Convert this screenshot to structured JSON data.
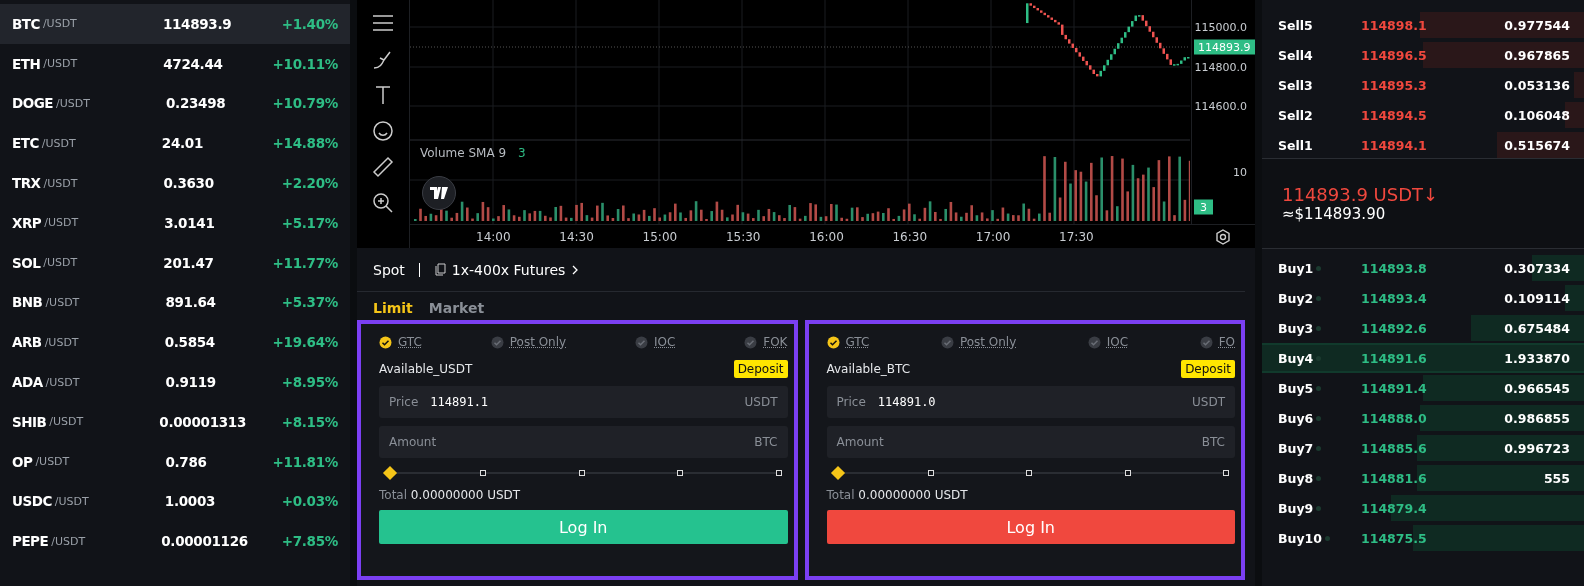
{
  "markets": [
    {
      "base": "BTC",
      "quote": "/USDT",
      "price": "114893.9",
      "change": "+1.40%",
      "selected": true
    },
    {
      "base": "ETH",
      "quote": "/USDT",
      "price": "4724.44",
      "change": "+10.11%",
      "selected": false
    },
    {
      "base": "DOGE",
      "quote": "/USDT",
      "price": "0.23498",
      "change": "+10.79%",
      "selected": false
    },
    {
      "base": "ETC",
      "quote": "/USDT",
      "price": "24.01",
      "change": "+14.88%",
      "selected": false
    },
    {
      "base": "TRX",
      "quote": "/USDT",
      "price": "0.3630",
      "change": "+2.20%",
      "selected": false
    },
    {
      "base": "XRP",
      "quote": "/USDT",
      "price": "3.0141",
      "change": "+5.17%",
      "selected": false
    },
    {
      "base": "SOL",
      "quote": "/USDT",
      "price": "201.47",
      "change": "+11.77%",
      "selected": false
    },
    {
      "base": "BNB",
      "quote": "/USDT",
      "price": "891.64",
      "change": "+5.37%",
      "selected": false
    },
    {
      "base": "ARB",
      "quote": "/USDT",
      "price": "0.5854",
      "change": "+19.64%",
      "selected": false
    },
    {
      "base": "ADA",
      "quote": "/USDT",
      "price": "0.9119",
      "change": "+8.95%",
      "selected": false
    },
    {
      "base": "SHIB",
      "quote": "/USDT",
      "price": "0.00001313",
      "change": "+8.15%",
      "selected": false
    },
    {
      "base": "OP",
      "quote": "/USDT",
      "price": "0.786",
      "change": "+11.81%",
      "selected": false
    },
    {
      "base": "USDC",
      "quote": "/USDT",
      "price": "1.0003",
      "change": "+0.03%",
      "selected": false
    },
    {
      "base": "PEPE",
      "quote": "/USDT",
      "price": "0.00001126",
      "change": "+7.85%",
      "selected": false
    }
  ],
  "chart": {
    "price_ticks": [
      "115000.0",
      "114800.0",
      "114600.0"
    ],
    "last_price": "114893.9",
    "volume_label": "Volume SMA 9",
    "volume_value": "3",
    "volume_tick": "10",
    "volume_tag": "3",
    "time_ticks": [
      "14:00",
      "14:30",
      "15:00",
      "15:30",
      "16:00",
      "16:30",
      "17:00",
      "17:30"
    ]
  },
  "order": {
    "modes": [
      {
        "label": "Spot",
        "kind": "plain"
      },
      {
        "label": "1x-400x Futures",
        "kind": "link"
      }
    ],
    "types": [
      {
        "label": "Limit",
        "selected": true
      },
      {
        "label": "Market",
        "selected": false
      }
    ],
    "forms": [
      {
        "kind": "buy",
        "options": [
          {
            "label": "GTC",
            "checked": true
          },
          {
            "label": "Post Only",
            "checked": false
          },
          {
            "label": "IOC",
            "checked": false
          },
          {
            "label": "FOK",
            "checked": false
          }
        ],
        "available": "Available_USDT",
        "deposit": "Deposit",
        "price_label": "Price",
        "price_value": "114891.1",
        "price_unit": "USDT",
        "amount_label": "Amount",
        "amount_unit": "BTC",
        "level": 0,
        "total_label": "Total",
        "total_value": "0.00000000 USDT",
        "button": "Log In"
      },
      {
        "kind": "sell",
        "options": [
          {
            "label": "GTC",
            "checked": true
          },
          {
            "label": "Post Only",
            "checked": false
          },
          {
            "label": "IOC",
            "checked": false
          },
          {
            "label": "FO",
            "checked": false
          }
        ],
        "available": "Available_BTC",
        "deposit": "Deposit",
        "price_label": "Price",
        "price_value": "114891.0",
        "price_unit": "USDT",
        "amount_label": "Amount",
        "amount_unit": "BTC",
        "level": 0,
        "total_label": "Total",
        "total_value": "0.00000000 USDT",
        "button": "Log In"
      }
    ]
  },
  "orderbook": {
    "asks": [
      {
        "label": "Sell5",
        "price": "114898.1",
        "amount": "0.977544",
        "level": 0.51
      },
      {
        "label": "Sell4",
        "price": "114896.5",
        "amount": "0.967865",
        "level": 0.5
      },
      {
        "label": "Sell3",
        "price": "114895.3",
        "amount": "0.053136",
        "level": 0.03
      },
      {
        "label": "Sell2",
        "price": "114894.5",
        "amount": "0.106048",
        "level": 0.06
      },
      {
        "label": "Sell1",
        "price": "114894.1",
        "amount": "0.515674",
        "level": 0.27
      }
    ],
    "mid_price": "114893.9 USDT↓",
    "mid_fiat": "≈$114893.90",
    "bids": [
      {
        "label": "Buy1",
        "price": "114893.8",
        "amount": "0.307334",
        "level": 0.16,
        "selected": false
      },
      {
        "label": "Buy2",
        "price": "114893.4",
        "amount": "0.109114",
        "level": 0.06,
        "selected": false
      },
      {
        "label": "Buy3",
        "price": "114892.6",
        "amount": "0.675484",
        "level": 0.35,
        "selected": false
      },
      {
        "label": "Buy4",
        "price": "114891.6",
        "amount": "1.933870",
        "level": 1,
        "selected": true
      },
      {
        "label": "Buy5",
        "price": "114891.4",
        "amount": "0.966545",
        "level": 0.5,
        "selected": false
      },
      {
        "label": "Buy6",
        "price": "114888.0",
        "amount": "0.986855",
        "level": 0.51,
        "selected": false
      },
      {
        "label": "Buy7",
        "price": "114885.6",
        "amount": "0.996723",
        "level": 0.52,
        "selected": false
      },
      {
        "label": "Buy8",
        "price": "114881.6",
        "amount": "555",
        "level": 0.52,
        "selected": false
      },
      {
        "label": "Buy9",
        "price": "114879.4",
        "level": 0.6,
        "selected": false
      },
      {
        "label": "Buy10",
        "price": "114875.5",
        "level": 0.53,
        "selected": false
      }
    ]
  }
}
